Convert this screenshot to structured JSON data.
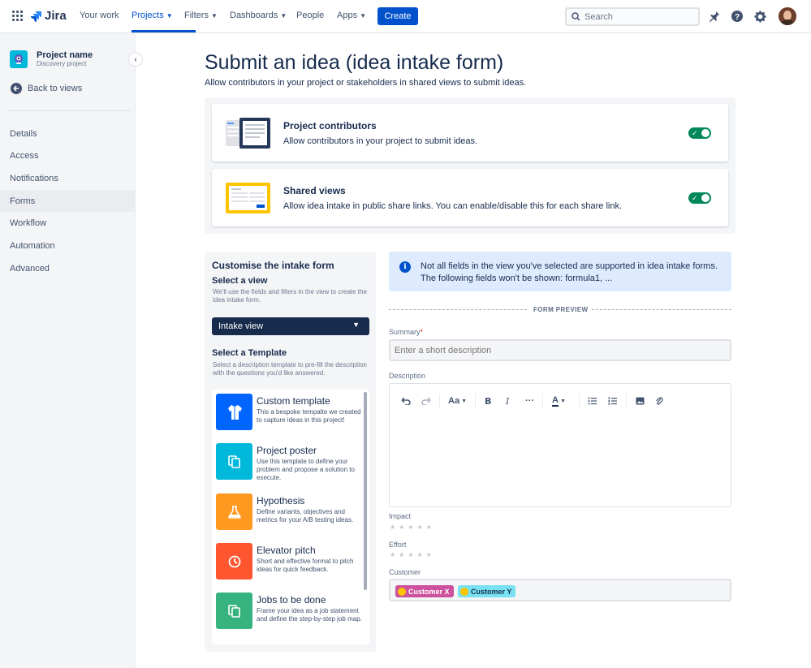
{
  "topnav": {
    "logo": "Jira",
    "items": [
      {
        "label": "Your work",
        "dropdown": false
      },
      {
        "label": "Projects",
        "dropdown": true
      },
      {
        "label": "Filters",
        "dropdown": true
      },
      {
        "label": "Dashboards",
        "dropdown": true
      },
      {
        "label": "People",
        "dropdown": false
      },
      {
        "label": "Apps",
        "dropdown": true
      }
    ],
    "active_item": "Projects",
    "create_label": "Create",
    "search_placeholder": "Search",
    "icons": [
      "notifications-icon",
      "help-icon",
      "settings-icon",
      "avatar"
    ]
  },
  "sidebar": {
    "project_name": "Project name",
    "project_type": "Discovery project",
    "back_label": "Back to views",
    "items": [
      "Details",
      "Access",
      "Notifications",
      "Forms",
      "Workflow",
      "Automation",
      "Advanced"
    ],
    "active_item": "Forms"
  },
  "main": {
    "title": "Submit an idea (idea intake form)",
    "subtitle": "Allow contributors in your project or stakeholders in shared views to submit ideas.",
    "toggles": [
      {
        "title": "Project contributors",
        "description": "Allow contributors in your project to submit ideas.",
        "enabled": true
      },
      {
        "title": "Shared views",
        "description": "Allow idea intake in public share links. You can enable/disable this for each share link.",
        "enabled": true
      }
    ]
  },
  "customise": {
    "title": "Customise the intake form",
    "view_heading": "Select a view",
    "view_help": "We'll use the fields and filters in the view to create the idea intake form.",
    "selected_view": "Intake view",
    "template_heading": "Select a Template",
    "template_help": "Select a description template to pre-fill the description with the questions you'd like answered.",
    "templates": [
      {
        "title": "Custom template",
        "description": "This a bespoke tempalte we created to capture ideas in this project!",
        "color": "#0065FF",
        "icon": "shirt-icon"
      },
      {
        "title": "Project poster",
        "description": "Use this template to define your problem and propose a solution to execute.",
        "color": "#00B8D9",
        "icon": "copy-icon"
      },
      {
        "title": "Hypothesis",
        "description": "Define variants, objectives and metrics for your A/B testing ideas.",
        "color": "#FF991F",
        "icon": "flask-icon"
      },
      {
        "title": "Elevator pitch",
        "description": "Short and effective format to pitch ideas for quick feedback.",
        "color": "#FF5630",
        "icon": "clock-icon"
      },
      {
        "title": "Jobs to be done",
        "description": "Frame your idea as a job statement and define the step-by-step job map.",
        "color": "#36B37E",
        "icon": "copy-icon"
      }
    ]
  },
  "info_banner": "Not all fields in the view you've selected are supported in idea intake forms. The following fields won't be shown: formula1, ...",
  "form_preview": {
    "label": "FORM PREVIEW",
    "summary_label": "Summary",
    "summary_required": "*",
    "summary_placeholder": "Enter a short description",
    "description_label": "Description",
    "toolbar": [
      "undo-icon",
      "redo-icon",
      "text-style-icon",
      "bold-icon",
      "italic-icon",
      "more-icon",
      "text-color-icon",
      "bullet-list-icon",
      "numbered-list-icon",
      "image-icon",
      "link-icon"
    ],
    "toolbar_text_style": "Aa",
    "impact_label": "Impact",
    "effort_label": "Effort",
    "customer_label": "Customer",
    "customers": [
      {
        "label": "Customer X",
        "bg": "#CD519D",
        "fg": "#FFFFFF"
      },
      {
        "label": "Customer Y",
        "bg": "#79E2F2",
        "fg": "#172B4D"
      }
    ]
  }
}
